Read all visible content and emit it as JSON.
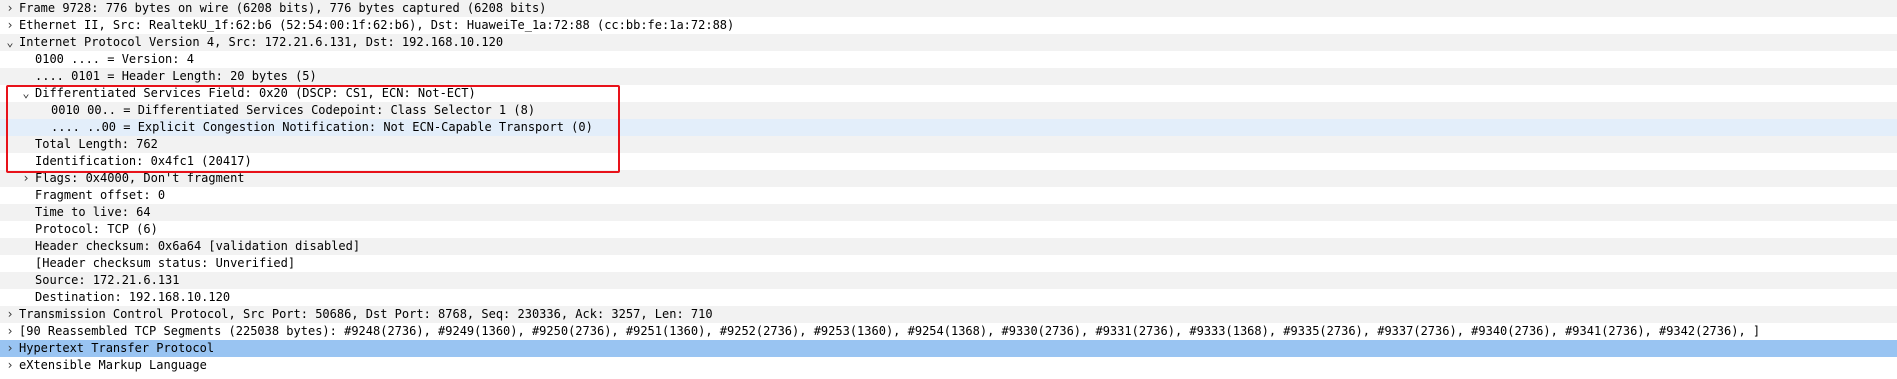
{
  "tree": {
    "rows": [
      {
        "text": "Frame 9728: 776 bytes on wire (6208 bits), 776 bytes captured (6208 bits)",
        "level": 0,
        "toggle": "collapsed"
      },
      {
        "text": "Ethernet II, Src: RealtekU_1f:62:b6 (52:54:00:1f:62:b6), Dst: HuaweiTe_1a:72:88 (cc:bb:fe:1a:72:88)",
        "level": 0,
        "toggle": "collapsed"
      },
      {
        "text": "Internet Protocol Version 4, Src: 172.21.6.131, Dst: 192.168.10.120",
        "level": 0,
        "toggle": "expanded"
      },
      {
        "text": "0100 .... = Version: 4",
        "level": 1,
        "toggle": "none"
      },
      {
        "text": ".... 0101 = Header Length: 20 bytes (5)",
        "level": 1,
        "toggle": "none"
      },
      {
        "text": "Differentiated Services Field: 0x20 (DSCP: CS1, ECN: Not-ECT)",
        "level": 1,
        "toggle": "expanded"
      },
      {
        "text": "0010 00.. = Differentiated Services Codepoint: Class Selector 1 (8)",
        "level": 2,
        "toggle": "none"
      },
      {
        "text": ".... ..00 = Explicit Congestion Notification: Not ECN-Capable Transport (0)",
        "level": 2,
        "toggle": "none"
      },
      {
        "text": "Total Length: 762",
        "level": 1,
        "toggle": "none"
      },
      {
        "text": "Identification: 0x4fc1 (20417)",
        "level": 1,
        "toggle": "none"
      },
      {
        "text": "Flags: 0x4000, Don't fragment",
        "level": 1,
        "toggle": "collapsed"
      },
      {
        "text": "Fragment offset: 0",
        "level": 1,
        "toggle": "none"
      },
      {
        "text": "Time to live: 64",
        "level": 1,
        "toggle": "none"
      },
      {
        "text": "Protocol: TCP (6)",
        "level": 1,
        "toggle": "none"
      },
      {
        "text": "Header checksum: 0x6a64 [validation disabled]",
        "level": 1,
        "toggle": "none"
      },
      {
        "text": "[Header checksum status: Unverified]",
        "level": 1,
        "toggle": "none"
      },
      {
        "text": "Source: 172.21.6.131",
        "level": 1,
        "toggle": "none"
      },
      {
        "text": "Destination: 192.168.10.120",
        "level": 1,
        "toggle": "none"
      },
      {
        "text": "Transmission Control Protocol, Src Port: 50686, Dst Port: 8768, Seq: 230336, Ack: 3257, Len: 710",
        "level": 0,
        "toggle": "collapsed"
      },
      {
        "text": "[90 Reassembled TCP Segments (225038 bytes): #9248(2736), #9249(1360), #9250(2736), #9251(1360), #9252(2736), #9253(1360), #9254(1368), #9330(2736), #9331(2736), #9333(1368), #9335(2736), #9337(2736), #9340(2736), #9341(2736), #9342(2736), ]",
        "level": 0,
        "toggle": "collapsed"
      },
      {
        "text": "Hypertext Transfer Protocol",
        "level": 0,
        "toggle": "collapsed"
      },
      {
        "text": "eXtensible Markup Language",
        "level": 0,
        "toggle": "collapsed"
      }
    ],
    "hovered_row": 7,
    "selected_row": 20,
    "collapsed_glyph": "›",
    "expanded_glyph": "⌄"
  },
  "annotation": {
    "box_color": "#e8121a",
    "first_row": 5,
    "last_row": 9
  }
}
